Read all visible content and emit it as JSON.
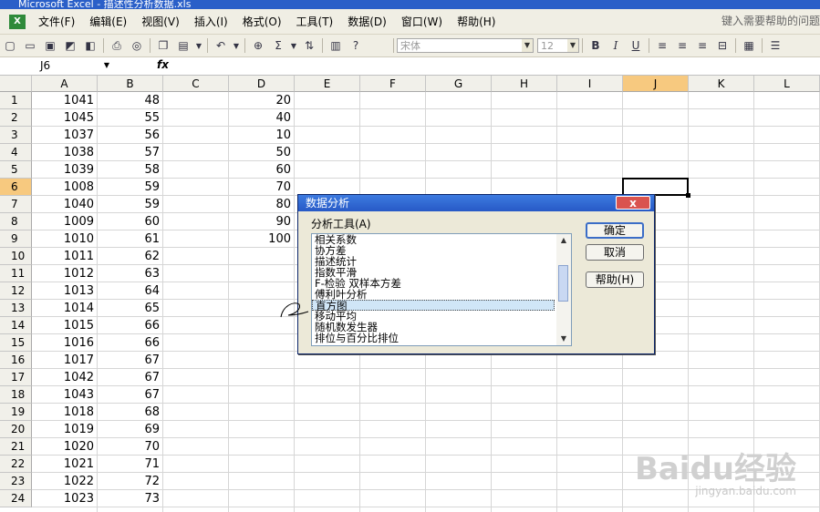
{
  "window": {
    "title": "Microsoft Excel - 描述性分析数据.xls"
  },
  "menu": {
    "items": [
      "文件(F)",
      "编辑(E)",
      "视图(V)",
      "插入(I)",
      "格式(O)",
      "工具(T)",
      "数据(D)",
      "窗口(W)",
      "帮助(H)"
    ],
    "help_placeholder": "键入需要帮助的问题"
  },
  "toolbar": {
    "font_name": "宋体",
    "font_size": "12",
    "bold": "B",
    "italic": "I",
    "underline": "U",
    "sigma": "Σ"
  },
  "formula": {
    "cell_ref": "J6",
    "fx": "fx"
  },
  "sheet": {
    "columns": [
      "A",
      "B",
      "C",
      "D",
      "E",
      "F",
      "G",
      "H",
      "I",
      "J",
      "K",
      "L"
    ],
    "active_column": "J",
    "active_row": 6,
    "rows": [
      "1",
      "2",
      "3",
      "4",
      "5",
      "6",
      "7",
      "8",
      "9",
      "10",
      "11",
      "12",
      "13",
      "14",
      "15",
      "16",
      "17",
      "18",
      "19",
      "20",
      "21",
      "22",
      "23",
      "24"
    ],
    "col_a": [
      "1041",
      "1045",
      "1037",
      "1038",
      "1039",
      "1008",
      "1040",
      "1009",
      "1010",
      "1011",
      "1012",
      "1013",
      "1014",
      "1015",
      "1016",
      "1017",
      "1042",
      "1043",
      "1018",
      "1019",
      "1020",
      "1021",
      "1022",
      "1023"
    ],
    "col_b": [
      "48",
      "55",
      "56",
      "57",
      "58",
      "59",
      "59",
      "60",
      "61",
      "62",
      "63",
      "64",
      "65",
      "66",
      "66",
      "67",
      "67",
      "67",
      "68",
      "69",
      "70",
      "71",
      "72",
      "73"
    ],
    "col_d": [
      "20",
      "40",
      "10",
      "50",
      "60",
      "70",
      "80",
      "90",
      "100"
    ]
  },
  "dialog": {
    "title": "数据分析",
    "close": "x",
    "tools_label": "分析工具(A)",
    "items": [
      "相关系数",
      "协方差",
      "描述统计",
      "指数平滑",
      "F-检验 双样本方差",
      "傅利叶分析",
      "直方图",
      "移动平均",
      "随机数发生器",
      "排位与百分比排位"
    ],
    "selected_index": 6,
    "ok": "确定",
    "cancel": "取消",
    "help": "帮助(H)"
  },
  "watermark": {
    "brand": "Baidu经验",
    "site": "jingyan.baidu.com"
  }
}
